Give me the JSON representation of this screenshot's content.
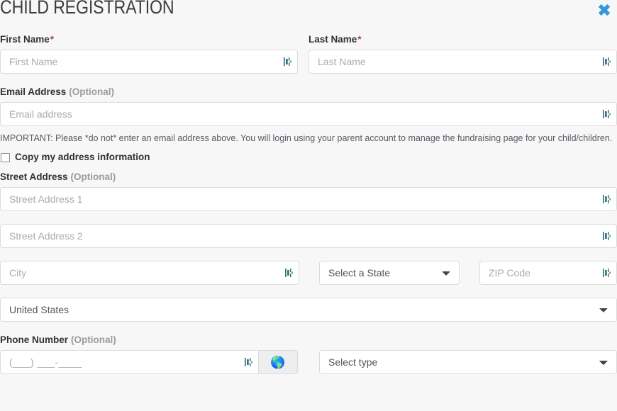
{
  "header": {
    "title": "CHILD REGISTRATION",
    "close_label": "✖",
    "close_color": "#3498db"
  },
  "colors": {
    "page_background": "#f7f7f7",
    "input_background": "#ffffff",
    "input_border": "#dcdcdc",
    "label_text": "#333333",
    "optional_text": "#9b9b9b",
    "required_asterisk": "#a94442",
    "placeholder_text": "#aaaaaa",
    "helper_text": "#555d66",
    "autofill_icon": "#2c6e77",
    "globe_button_background": "#eeeeee"
  },
  "optional_suffix": "(Optional)",
  "required_marker": "*",
  "fields": {
    "first_name": {
      "label": "First Name",
      "placeholder": "First Name",
      "value": "",
      "required": true
    },
    "last_name": {
      "label": "Last Name",
      "placeholder": "Last Name",
      "value": "",
      "required": true
    },
    "email": {
      "label": "Email Address",
      "placeholder": "Email address",
      "value": "",
      "required": false
    },
    "street_address": {
      "label": "Street Address",
      "line1_placeholder": "Street Address 1",
      "line1_value": "",
      "line2_placeholder": "Street Address 2",
      "line2_value": ""
    },
    "city": {
      "placeholder": "City",
      "value": ""
    },
    "state": {
      "selected": "Select a State"
    },
    "zip": {
      "placeholder": "ZIP Code",
      "value": ""
    },
    "country": {
      "selected": "United States"
    },
    "phone": {
      "label": "Phone Number",
      "placeholder": "(___) ___-____",
      "value": "",
      "globe_icon": "🌎",
      "type_selected": "Select type"
    }
  },
  "messages": {
    "email_notice": "IMPORTANT: Please *do not* enter an email address above. You will login using your parent account to manage the fundraising page for your child/children."
  },
  "checkbox": {
    "copy_address_label": "Copy my address information",
    "checked": false
  }
}
